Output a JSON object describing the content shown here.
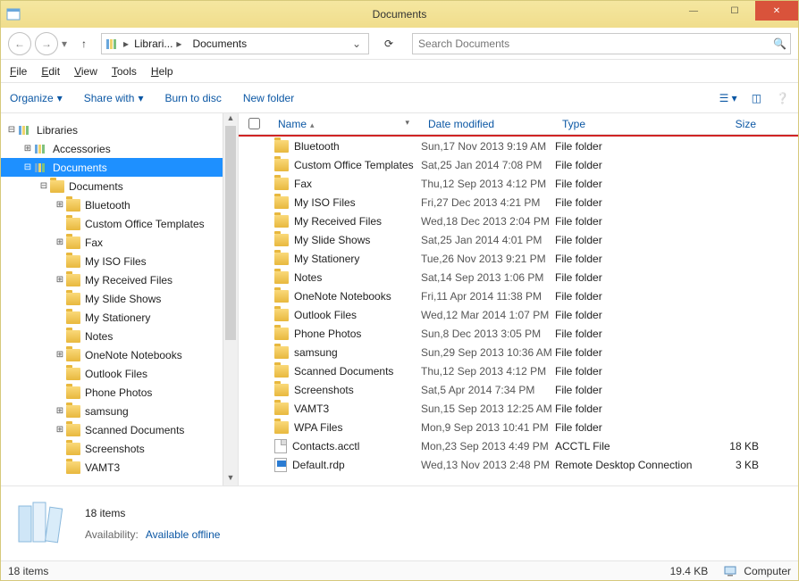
{
  "window": {
    "title": "Documents"
  },
  "breadcrumb": {
    "segments": [
      "Librari...",
      "Documents"
    ]
  },
  "search": {
    "placeholder": "Search Documents"
  },
  "menubar": [
    "File",
    "Edit",
    "View",
    "Tools",
    "Help"
  ],
  "toolbar": {
    "organize": "Organize",
    "share": "Share with",
    "burn": "Burn to disc",
    "newfolder": "New folder"
  },
  "columns": {
    "name": "Name",
    "date": "Date modified",
    "type": "Type",
    "size": "Size"
  },
  "tree": {
    "root": "Libraries",
    "items": [
      {
        "name": "Accessories",
        "depth": 1,
        "expandable": true,
        "expanded": false,
        "icon": "lib"
      },
      {
        "name": "Documents",
        "depth": 1,
        "expandable": true,
        "expanded": true,
        "icon": "lib",
        "selected": true
      },
      {
        "name": "Documents",
        "depth": 2,
        "expandable": true,
        "expanded": true,
        "icon": "folder"
      },
      {
        "name": "Bluetooth",
        "depth": 3,
        "expandable": true,
        "expanded": false,
        "icon": "folder"
      },
      {
        "name": "Custom Office Templates",
        "depth": 3,
        "expandable": false,
        "icon": "folder"
      },
      {
        "name": "Fax",
        "depth": 3,
        "expandable": true,
        "expanded": false,
        "icon": "folder"
      },
      {
        "name": "My ISO Files",
        "depth": 3,
        "expandable": false,
        "icon": "folder"
      },
      {
        "name": "My Received Files",
        "depth": 3,
        "expandable": true,
        "expanded": false,
        "icon": "folder"
      },
      {
        "name": "My Slide Shows",
        "depth": 3,
        "expandable": false,
        "icon": "folder"
      },
      {
        "name": "My Stationery",
        "depth": 3,
        "expandable": false,
        "icon": "folder"
      },
      {
        "name": "Notes",
        "depth": 3,
        "expandable": false,
        "icon": "folder"
      },
      {
        "name": "OneNote Notebooks",
        "depth": 3,
        "expandable": true,
        "expanded": false,
        "icon": "folder"
      },
      {
        "name": "Outlook Files",
        "depth": 3,
        "expandable": false,
        "icon": "folder"
      },
      {
        "name": "Phone Photos",
        "depth": 3,
        "expandable": false,
        "icon": "folder"
      },
      {
        "name": "samsung",
        "depth": 3,
        "expandable": true,
        "expanded": false,
        "icon": "folder"
      },
      {
        "name": "Scanned Documents",
        "depth": 3,
        "expandable": true,
        "expanded": false,
        "icon": "folder"
      },
      {
        "name": "Screenshots",
        "depth": 3,
        "expandable": false,
        "icon": "folder"
      },
      {
        "name": "VAMT3",
        "depth": 3,
        "expandable": false,
        "icon": "folder"
      }
    ]
  },
  "files": [
    {
      "name": "Bluetooth",
      "date": "Sun,17 Nov 2013 9:19 AM",
      "type": "File folder",
      "size": "",
      "icon": "folder"
    },
    {
      "name": "Custom Office Templates",
      "date": "Sat,25 Jan 2014 7:08 PM",
      "type": "File folder",
      "size": "",
      "icon": "folder"
    },
    {
      "name": "Fax",
      "date": "Thu,12 Sep 2013 4:12 PM",
      "type": "File folder",
      "size": "",
      "icon": "folder"
    },
    {
      "name": "My ISO Files",
      "date": "Fri,27 Dec 2013 4:21 PM",
      "type": "File folder",
      "size": "",
      "icon": "folder"
    },
    {
      "name": "My Received Files",
      "date": "Wed,18 Dec 2013 2:04 PM",
      "type": "File folder",
      "size": "",
      "icon": "folder"
    },
    {
      "name": "My Slide Shows",
      "date": "Sat,25 Jan 2014 4:01 PM",
      "type": "File folder",
      "size": "",
      "icon": "folder"
    },
    {
      "name": "My Stationery",
      "date": "Tue,26 Nov 2013 9:21 PM",
      "type": "File folder",
      "size": "",
      "icon": "folder"
    },
    {
      "name": "Notes",
      "date": "Sat,14 Sep 2013 1:06 PM",
      "type": "File folder",
      "size": "",
      "icon": "folder"
    },
    {
      "name": "OneNote Notebooks",
      "date": "Fri,11 Apr 2014 11:38 PM",
      "type": "File folder",
      "size": "",
      "icon": "folder"
    },
    {
      "name": "Outlook Files",
      "date": "Wed,12 Mar 2014 1:07 PM",
      "type": "File folder",
      "size": "",
      "icon": "folder"
    },
    {
      "name": "Phone Photos",
      "date": "Sun,8 Dec 2013 3:05 PM",
      "type": "File folder",
      "size": "",
      "icon": "folder"
    },
    {
      "name": "samsung",
      "date": "Sun,29 Sep 2013 10:36 AM",
      "type": "File folder",
      "size": "",
      "icon": "folder"
    },
    {
      "name": "Scanned Documents",
      "date": "Thu,12 Sep 2013 4:12 PM",
      "type": "File folder",
      "size": "",
      "icon": "folder"
    },
    {
      "name": "Screenshots",
      "date": "Sat,5 Apr 2014 7:34 PM",
      "type": "File folder",
      "size": "",
      "icon": "folder"
    },
    {
      "name": "VAMT3",
      "date": "Sun,15 Sep 2013 12:25 AM",
      "type": "File folder",
      "size": "",
      "icon": "folder"
    },
    {
      "name": "WPA Files",
      "date": "Mon,9 Sep 2013 10:41 PM",
      "type": "File folder",
      "size": "",
      "icon": "folder"
    },
    {
      "name": "Contacts.acctl",
      "date": "Mon,23 Sep 2013 4:49 PM",
      "type": "ACCTL File",
      "size": "18 KB",
      "icon": "file"
    },
    {
      "name": "Default.rdp",
      "date": "Wed,13 Nov 2013 2:48 PM",
      "type": "Remote Desktop Connection",
      "size": "3 KB",
      "icon": "rdp"
    }
  ],
  "details": {
    "count": "18 items",
    "availability_label": "Availability:",
    "availability_value": "Available offline"
  },
  "statusbar": {
    "items": "18 items",
    "size": "19.4 KB",
    "location": "Computer"
  }
}
